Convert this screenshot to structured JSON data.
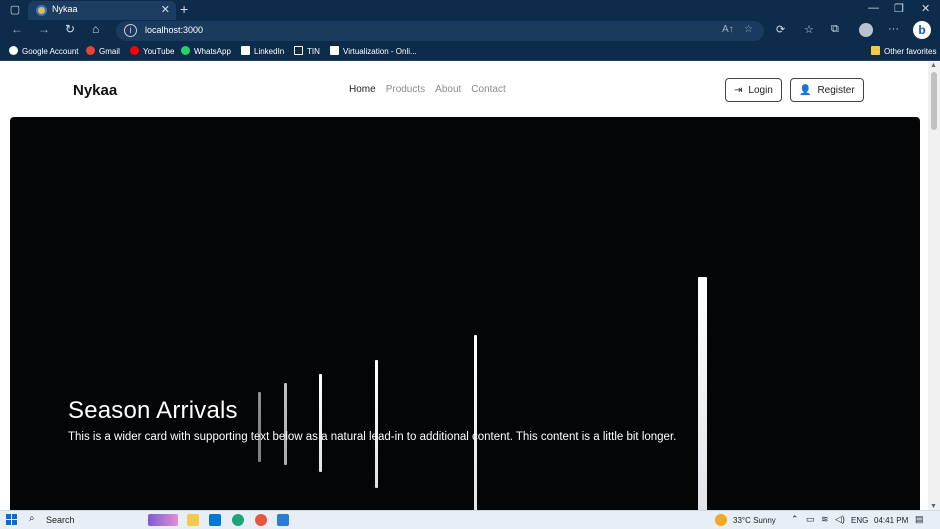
{
  "browser": {
    "tab_title": "Nykaa",
    "new_tab_symbol": "+",
    "close_symbol": "✕",
    "url": "localhost:3000",
    "bookmarks": [
      {
        "label": "Google Account",
        "icon": "google-icon",
        "color": "#ffffff"
      },
      {
        "label": "Gmail",
        "icon": "gmail-icon",
        "color": "#ea4335"
      },
      {
        "label": "YouTube",
        "icon": "youtube-icon",
        "color": "#ff0000"
      },
      {
        "label": "WhatsApp",
        "icon": "whatsapp-icon",
        "color": "#25d366"
      },
      {
        "label": "LinkedIn",
        "icon": "linkedin-icon",
        "color": "#ffffff"
      },
      {
        "label": "TIN",
        "icon": "document-icon",
        "color": "#ffffff"
      },
      {
        "label": "Virtualization - Onli...",
        "icon": "n-icon",
        "color": "#ffffff"
      }
    ],
    "other_favorites": "Other favorites"
  },
  "site": {
    "brand": "Nykaa",
    "nav": [
      {
        "label": "Home",
        "active": true
      },
      {
        "label": "Products",
        "active": false
      },
      {
        "label": "About",
        "active": false
      },
      {
        "label": "Contact",
        "active": false
      }
    ],
    "login_label": "Login",
    "register_label": "Register"
  },
  "hero": {
    "title": "Season Arrivals",
    "text": "This is a wider card with supporting text below as a natural lead-in to additional content. This content is a little bit longer."
  },
  "taskbar": {
    "search_label": "Search",
    "weather": "33°C  Sunny",
    "language": "ENG",
    "time": "04:41 PM"
  },
  "colors": {
    "chrome_bg": "#0d2c4c",
    "hero_bg": "#040506"
  }
}
